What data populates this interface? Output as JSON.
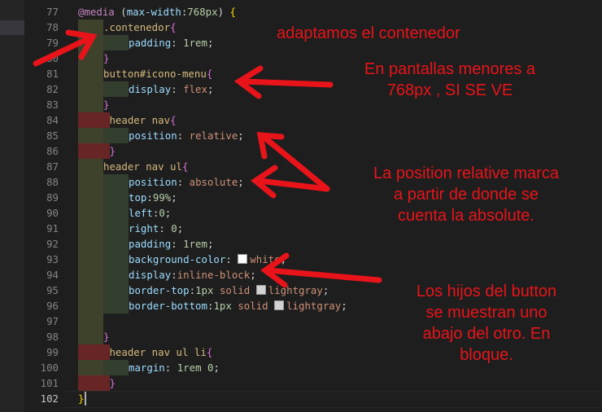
{
  "editor": {
    "active_line": 102,
    "lines": [
      {
        "n": 77,
        "indent": 0,
        "tokens": [
          [
            "@media",
            "at"
          ],
          [
            " (",
            "punc"
          ],
          [
            "max-width",
            "prop"
          ],
          [
            ":",
            "punc"
          ],
          [
            "768px",
            "num"
          ],
          [
            ") ",
            "punc"
          ],
          [
            "{",
            "brace1"
          ]
        ]
      },
      {
        "n": 78,
        "indent": 1,
        "tokens": [
          [
            ".contenedor",
            "sel"
          ],
          [
            "{",
            "brace2"
          ]
        ]
      },
      {
        "n": 79,
        "indent": 2,
        "tokens": [
          [
            "padding",
            "prop"
          ],
          [
            ": ",
            "punc"
          ],
          [
            "1rem",
            "num"
          ],
          [
            ";",
            "punc"
          ]
        ]
      },
      {
        "n": 80,
        "indent": 1,
        "tokens": [
          [
            "}",
            "brace2"
          ]
        ]
      },
      {
        "n": 81,
        "indent": 1,
        "tokens": [
          [
            "button#icono-menu",
            "sel"
          ],
          [
            "{",
            "brace2"
          ]
        ]
      },
      {
        "n": 82,
        "indent": 2,
        "tokens": [
          [
            "display",
            "prop"
          ],
          [
            ": ",
            "punc"
          ],
          [
            "flex",
            "val"
          ],
          [
            ";",
            "punc"
          ]
        ]
      },
      {
        "n": 83,
        "indent": 1,
        "tokens": [
          [
            "}",
            "brace2"
          ]
        ]
      },
      {
        "n": 84,
        "indent": 1,
        "tokens": [
          [
            " header nav",
            "sel"
          ],
          [
            "{",
            "brace2"
          ]
        ]
      },
      {
        "n": 85,
        "indent": 2,
        "tokens": [
          [
            "position",
            "prop"
          ],
          [
            ": ",
            "punc"
          ],
          [
            "relative",
            "val"
          ],
          [
            ";",
            "punc"
          ]
        ]
      },
      {
        "n": 86,
        "indent": 1,
        "tokens": [
          [
            " }",
            "brace2"
          ]
        ]
      },
      {
        "n": 87,
        "indent": 1,
        "tokens": [
          [
            "header nav ul",
            "sel"
          ],
          [
            "{",
            "brace2"
          ]
        ]
      },
      {
        "n": 88,
        "indent": 2,
        "tokens": [
          [
            "position",
            "prop"
          ],
          [
            ": ",
            "punc"
          ],
          [
            "absolute",
            "val"
          ],
          [
            ";",
            "punc"
          ]
        ]
      },
      {
        "n": 89,
        "indent": 2,
        "tokens": [
          [
            "top",
            "prop"
          ],
          [
            ":",
            "punc"
          ],
          [
            "99%",
            "num"
          ],
          [
            ";",
            "punc"
          ]
        ]
      },
      {
        "n": 90,
        "indent": 2,
        "tokens": [
          [
            "left",
            "prop"
          ],
          [
            ":",
            "punc"
          ],
          [
            "0",
            "num"
          ],
          [
            ";",
            "punc"
          ]
        ]
      },
      {
        "n": 91,
        "indent": 2,
        "tokens": [
          [
            "right",
            "prop"
          ],
          [
            ": ",
            "punc"
          ],
          [
            "0",
            "num"
          ],
          [
            ";",
            "punc"
          ]
        ]
      },
      {
        "n": 92,
        "indent": 2,
        "tokens": [
          [
            "padding",
            "prop"
          ],
          [
            ": ",
            "punc"
          ],
          [
            "1rem",
            "num"
          ],
          [
            ";",
            "punc"
          ]
        ]
      },
      {
        "n": 93,
        "indent": 2,
        "tokens": [
          [
            "background-color",
            "prop"
          ],
          [
            ": ",
            "punc"
          ],
          [
            "#ffffff",
            "swatch"
          ],
          [
            "white",
            "val"
          ],
          [
            ";",
            "punc"
          ]
        ]
      },
      {
        "n": 94,
        "indent": 2,
        "tokens": [
          [
            "display",
            "prop"
          ],
          [
            ":",
            "punc"
          ],
          [
            "inline-block",
            "val"
          ],
          [
            ";",
            "punc"
          ]
        ]
      },
      {
        "n": 95,
        "indent": 2,
        "tokens": [
          [
            "border-top",
            "prop"
          ],
          [
            ":",
            "punc"
          ],
          [
            "1px",
            "num"
          ],
          [
            " ",
            "punc"
          ],
          [
            "solid",
            "val"
          ],
          [
            " ",
            "punc"
          ],
          [
            "#d3d3d3",
            "swatch"
          ],
          [
            "lightgray",
            "val"
          ],
          [
            ";",
            "punc"
          ]
        ]
      },
      {
        "n": 96,
        "indent": 2,
        "tokens": [
          [
            "border-bottom",
            "prop"
          ],
          [
            ":",
            "punc"
          ],
          [
            "1px",
            "num"
          ],
          [
            " ",
            "punc"
          ],
          [
            "solid",
            "val"
          ],
          [
            " ",
            "punc"
          ],
          [
            "#d3d3d3",
            "swatch"
          ],
          [
            "lightgray",
            "val"
          ],
          [
            ";",
            "punc"
          ]
        ]
      },
      {
        "n": 97,
        "indent": 0,
        "tokens": []
      },
      {
        "n": 98,
        "indent": 1,
        "tokens": [
          [
            "}",
            "brace2"
          ]
        ]
      },
      {
        "n": 99,
        "indent": 1,
        "tokens": [
          [
            " header nav ul li",
            "sel"
          ],
          [
            "{",
            "brace2"
          ]
        ]
      },
      {
        "n": 100,
        "indent": 2,
        "tokens": [
          [
            "margin",
            "prop"
          ],
          [
            ": ",
            "punc"
          ],
          [
            "1rem",
            "num"
          ],
          [
            " ",
            "punc"
          ],
          [
            "0",
            "num"
          ],
          [
            ";",
            "punc"
          ]
        ]
      },
      {
        "n": 101,
        "indent": 1,
        "tokens": [
          [
            " }",
            "brace2"
          ]
        ]
      },
      {
        "n": 102,
        "indent": 0,
        "tokens": [
          [
            "}",
            "brace1"
          ]
        ]
      }
    ]
  },
  "annotations": {
    "contenedor": "adaptamos el contenedor",
    "icono_menu_1": "En pantallas menores a",
    "icono_menu_2": "768px , SI SE VE",
    "position_1": "La position relative marca",
    "position_2": "a partir de donde se",
    "position_3": "cuenta la absolute.",
    "hijos_1": "Los hijos del button",
    "hijos_2": "se muestran uno",
    "hijos_3": "abajo del otro. En",
    "hijos_4": "bloque."
  },
  "colors": {
    "annotation": "#e8141a",
    "background": "#1e1e1e"
  }
}
